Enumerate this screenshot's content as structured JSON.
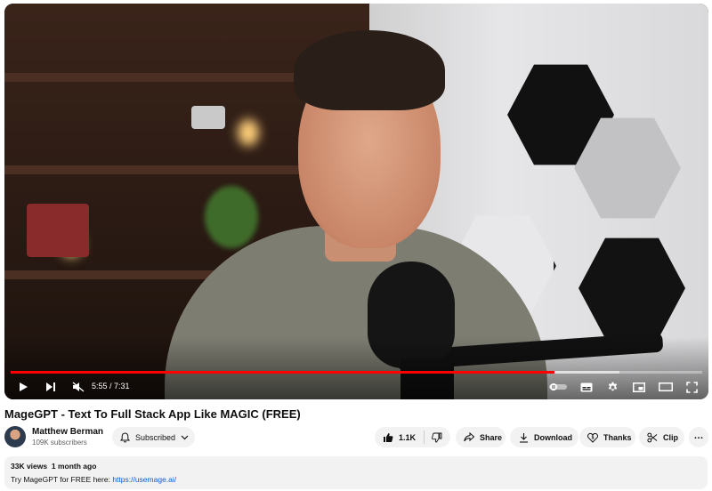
{
  "player": {
    "time_current": "5:55",
    "time_separator": " / ",
    "time_total": "7:31",
    "progress_played": 0.787,
    "progress_buffered": 0.88,
    "accent_color": "#ff0000",
    "icons": [
      "play-icon",
      "next-icon",
      "mute-icon",
      "autoplay-toggle",
      "subtitles-icon",
      "settings-icon",
      "miniplayer-icon",
      "theater-icon",
      "fullscreen-icon"
    ]
  },
  "video": {
    "title": "MageGPT - Text To Full Stack App Like MAGIC (FREE)"
  },
  "channel": {
    "name": "Matthew Berman",
    "subscribers": "109K subscribers",
    "subscribe_label": "Subscribed"
  },
  "actions": {
    "like_count": "1.1K",
    "share_label": "Share",
    "download_label": "Download",
    "thanks_label": "Thanks",
    "clip_label": "Clip",
    "more_label": "…"
  },
  "description": {
    "views": "33K views",
    "age": "1 month ago",
    "text": "Try MageGPT for FREE here: ",
    "link": "https://usemage.ai/"
  }
}
